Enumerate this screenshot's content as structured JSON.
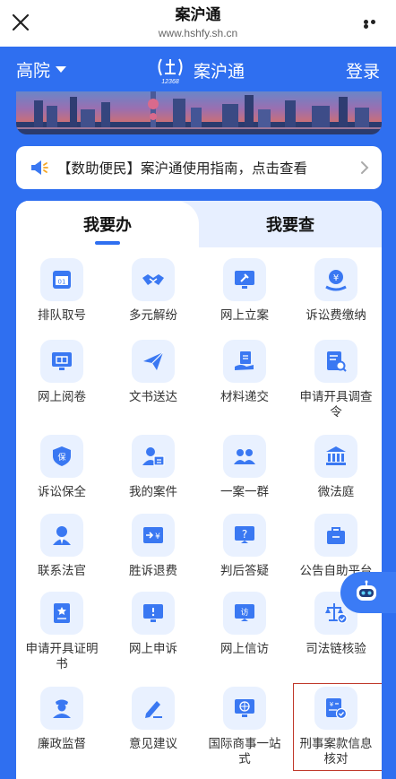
{
  "topbar": {
    "title": "案沪通",
    "url": "www.hshfy.sh.cn"
  },
  "header": {
    "court_selector": "高院",
    "brand_name": "案沪通",
    "login": "登录"
  },
  "notice": {
    "text": "【数助便民】案沪通使用指南，点击查看"
  },
  "tabs": [
    {
      "label": "我要办",
      "active": true
    },
    {
      "label": "我要查",
      "active": false
    }
  ],
  "services": [
    {
      "label": "排队取号",
      "icon": "queue-ticket-icon"
    },
    {
      "label": "多元解纷",
      "icon": "handshake-icon"
    },
    {
      "label": "网上立案",
      "icon": "gavel-screen-icon"
    },
    {
      "label": "诉讼费缴纳",
      "icon": "yuan-coin-icon"
    },
    {
      "label": "网上阅卷",
      "icon": "book-screen-icon"
    },
    {
      "label": "文书送达",
      "icon": "paper-plane-icon"
    },
    {
      "label": "材料递交",
      "icon": "hand-document-icon"
    },
    {
      "label": "申请开具调查令",
      "icon": "document-search-icon"
    },
    {
      "label": "诉讼保全",
      "icon": "shield-icon"
    },
    {
      "label": "我的案件",
      "icon": "user-card-icon"
    },
    {
      "label": "一案一群",
      "icon": "group-icon"
    },
    {
      "label": "微法庭",
      "icon": "courthouse-icon"
    },
    {
      "label": "联系法官",
      "icon": "judge-icon"
    },
    {
      "label": "胜诉退费",
      "icon": "refund-icon"
    },
    {
      "label": "判后答疑",
      "icon": "question-icon"
    },
    {
      "label": "公告自助平台",
      "icon": "briefcase-icon"
    },
    {
      "label": "申请开具证明书",
      "icon": "certificate-icon"
    },
    {
      "label": "网上申诉",
      "icon": "alert-screen-icon"
    },
    {
      "label": "网上信访",
      "icon": "visit-icon"
    },
    {
      "label": "司法链核验",
      "icon": "scales-check-icon"
    },
    {
      "label": "廉政监督",
      "icon": "officer-icon"
    },
    {
      "label": "意见建议",
      "icon": "edit-icon"
    },
    {
      "label": "国际商事一站式",
      "icon": "globe-screen-icon"
    },
    {
      "label": "刑事案款信息核对",
      "icon": "yuan-doc-check-icon"
    }
  ],
  "colors": {
    "primary": "#2f6ff0",
    "icon_bg": "#e9f1ff",
    "icon_blue": "#3a78f2",
    "highlight_border": "#c0392b"
  }
}
